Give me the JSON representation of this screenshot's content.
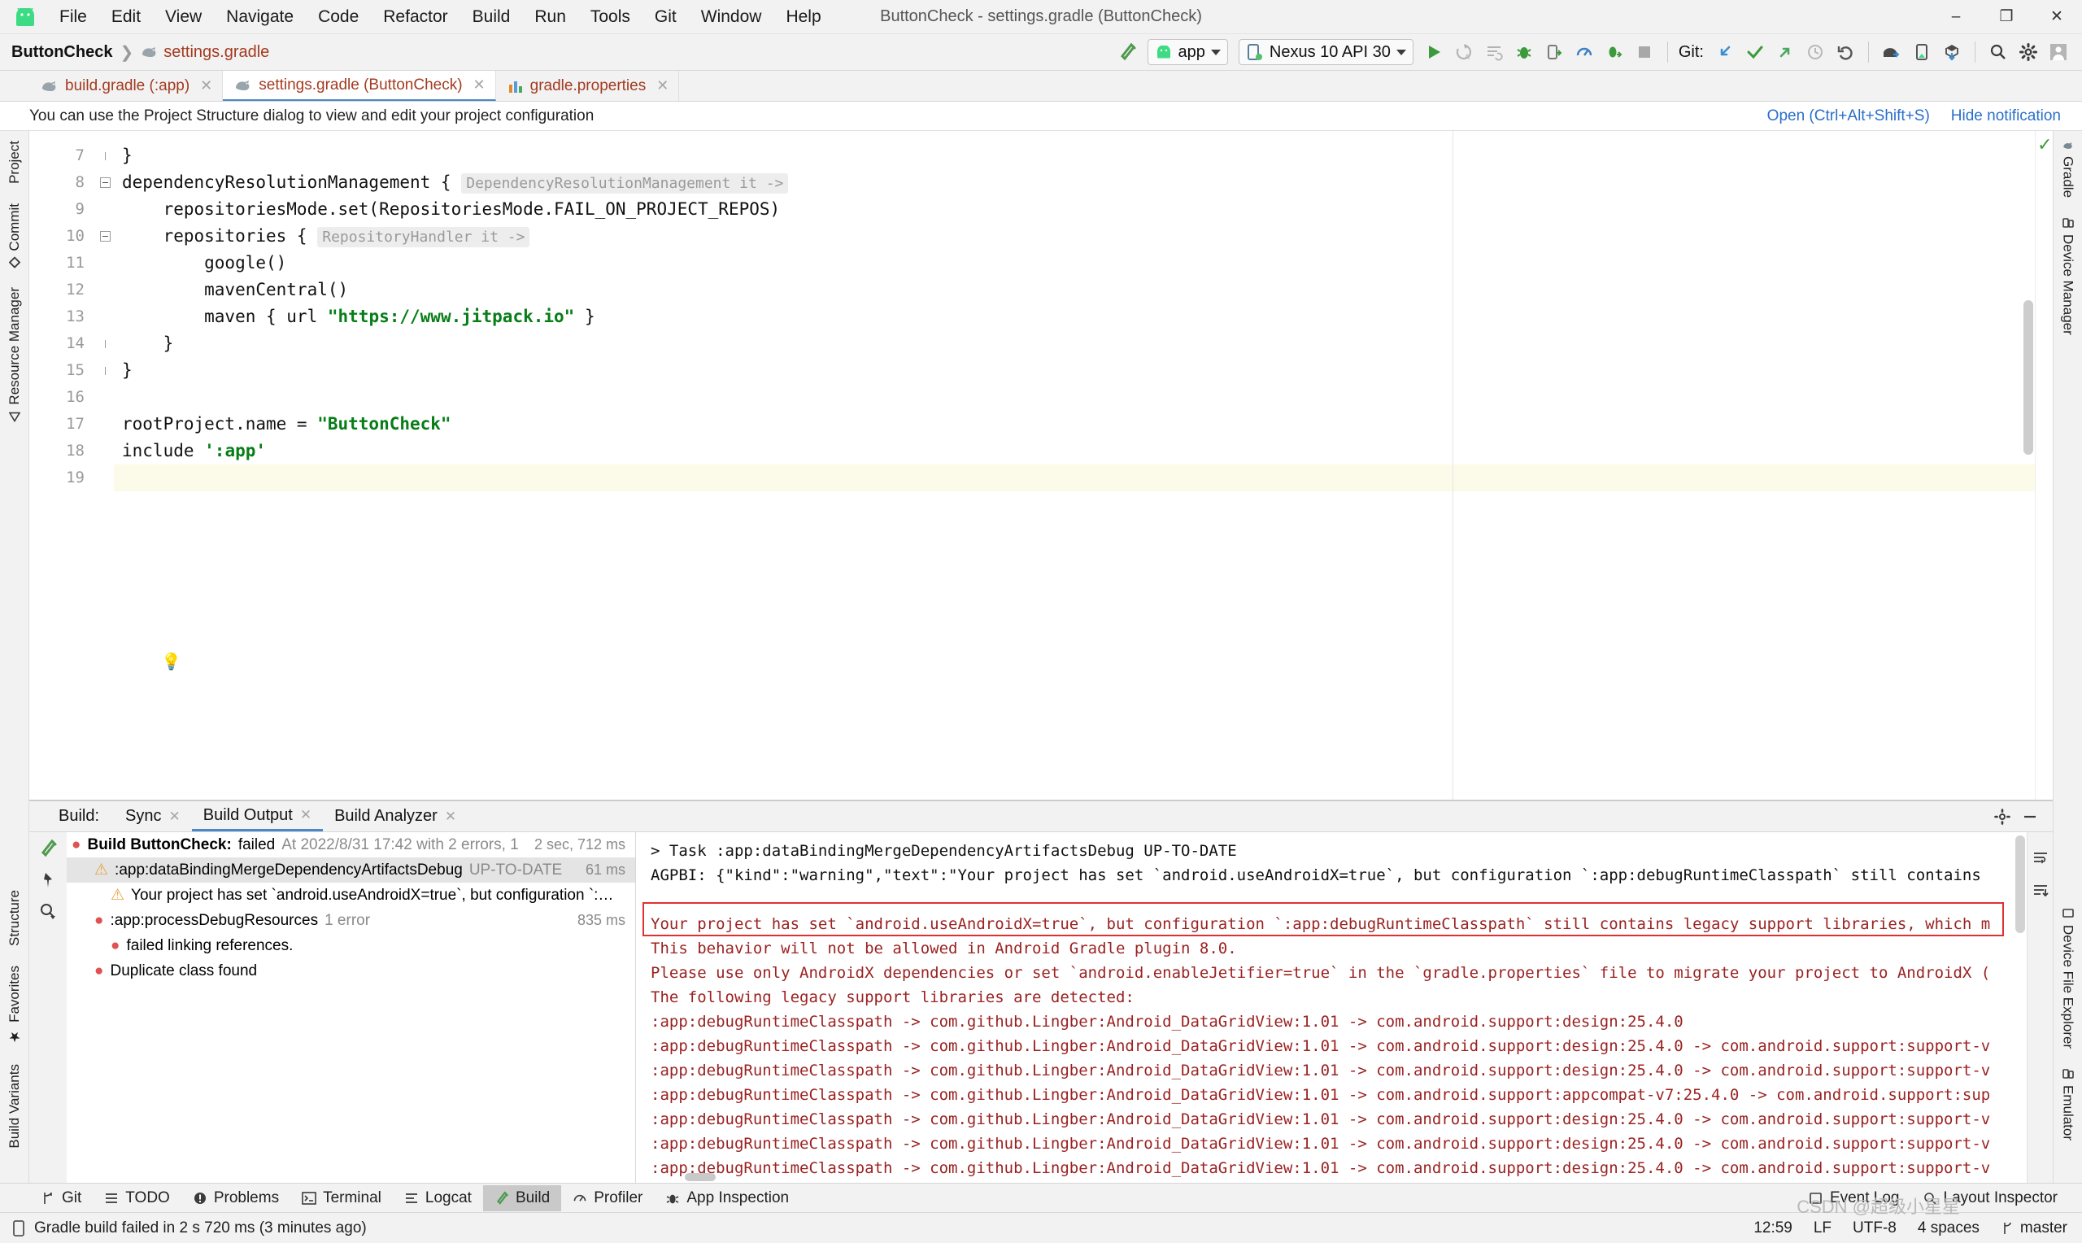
{
  "window": {
    "title": "ButtonCheck - settings.gradle (ButtonCheck)",
    "minimize": "–",
    "maximize": "❐",
    "close": "✕"
  },
  "menu": [
    {
      "label": "File"
    },
    {
      "label": "Edit"
    },
    {
      "label": "View"
    },
    {
      "label": "Navigate"
    },
    {
      "label": "Code"
    },
    {
      "label": "Refactor"
    },
    {
      "label": "Build"
    },
    {
      "label": "Run"
    },
    {
      "label": "Tools"
    },
    {
      "label": "Git"
    },
    {
      "label": "Window"
    },
    {
      "label": "Help"
    }
  ],
  "navbar": {
    "project": "ButtonCheck",
    "separator": "❯",
    "file": "settings.gradle",
    "run_config": "app",
    "device": "Nexus 10 API 30",
    "git_label": "Git:"
  },
  "editor_tabs": [
    {
      "label": "build.gradle (:app)",
      "icon": "gradle-icon",
      "active": false
    },
    {
      "label": "settings.gradle (ButtonCheck)",
      "icon": "gradle-icon",
      "active": true
    },
    {
      "label": "gradle.properties",
      "icon": "properties-icon",
      "active": false
    }
  ],
  "notification": {
    "text": "You can use the Project Structure dialog to view and edit your project configuration",
    "open_link": "Open (Ctrl+Alt+Shift+S)",
    "hide_link": "Hide notification"
  },
  "left_rail": [
    {
      "label": "Project"
    },
    {
      "label": "Commit"
    },
    {
      "label": "Resource Manager"
    }
  ],
  "right_rail": [
    {
      "label": "Gradle"
    },
    {
      "label": "Device Manager"
    },
    {
      "label": "Device File Explorer"
    },
    {
      "label": "Emulator"
    }
  ],
  "code": {
    "first_line": 7,
    "lines": [
      {
        "n": 7,
        "text": "}",
        "indent": 0
      },
      {
        "n": 8,
        "text": "dependencyResolutionManagement {",
        "hint": "DependencyResolutionManagement it ->"
      },
      {
        "n": 9,
        "text": "    repositoriesMode.set(RepositoriesMode.FAIL_ON_PROJECT_REPOS)"
      },
      {
        "n": 10,
        "text": "    repositories {",
        "hint": "RepositoryHandler it ->"
      },
      {
        "n": 11,
        "text": "        google()"
      },
      {
        "n": 12,
        "text": "        mavenCentral()"
      },
      {
        "n": 13,
        "text": "        maven { url \"https://www.jitpack.io\" }"
      },
      {
        "n": 14,
        "text": "    }"
      },
      {
        "n": 15,
        "text": "}"
      },
      {
        "n": 16,
        "text": ""
      },
      {
        "n": 17,
        "text": "rootProject.name = \"ButtonCheck\""
      },
      {
        "n": 18,
        "text": "include ':app'"
      },
      {
        "n": 19,
        "text": "",
        "current": true
      }
    ]
  },
  "build_panel": {
    "title": "Build:",
    "tabs": [
      {
        "label": "Sync",
        "active": false,
        "closable": true
      },
      {
        "label": "Build Output",
        "active": true,
        "closable": true
      },
      {
        "label": "Build Analyzer",
        "active": false,
        "closable": true
      }
    ],
    "tree": [
      {
        "level": 0,
        "icon": "error-icon",
        "bold": "Build ButtonCheck:",
        "text": " failed",
        "muted": " At 2022/8/31 17:42 with 2 errors, 1",
        "time": "2 sec, 712 ms",
        "selected": false
      },
      {
        "level": 1,
        "icon": "warning-icon",
        "text": ":app:dataBindingMergeDependencyArtifactsDebug",
        "muted": " UP-TO-DATE",
        "time": "61 ms",
        "selected": true
      },
      {
        "level": 2,
        "icon": "warning-icon",
        "text": "Your project has set `android.useAndroidX=true`, but configuration `:…",
        "time": "",
        "selected": false
      },
      {
        "level": 1,
        "icon": "error-icon",
        "text": ":app:processDebugResources",
        "muted": " 1 error",
        "time": "835 ms",
        "selected": false
      },
      {
        "level": 2,
        "icon": "error-icon",
        "text": "failed linking references.",
        "time": "",
        "selected": false
      },
      {
        "level": 1,
        "icon": "error-icon",
        "text": "Duplicate class found",
        "time": "",
        "selected": false
      }
    ],
    "log_lines": [
      {
        "text": "> Task :app:dataBindingMergeDependencyArtifactsDebug UP-TO-DATE",
        "red": false
      },
      {
        "text": "AGPBI: {\"kind\":\"warning\",\"text\":\"Your project has set `android.useAndroidX=true`, but configuration `:app:debugRuntimeClasspath` still contains",
        "red": false
      },
      {
        "text": "",
        "red": false
      },
      {
        "text": "Your project has set `android.useAndroidX=true`, but configuration `:app:debugRuntimeClasspath` still contains legacy support libraries, which m",
        "red": true,
        "highlighted": true
      },
      {
        "text": "This behavior will not be allowed in Android Gradle plugin 8.0.",
        "red": true
      },
      {
        "text": "Please use only AndroidX dependencies or set `android.enableJetifier=true` in the `gradle.properties` file to migrate your project to AndroidX (",
        "red": true
      },
      {
        "text": "The following legacy support libraries are detected:",
        "red": true
      },
      {
        "text": ":app:debugRuntimeClasspath -> com.github.Lingber:Android_DataGridView:1.01 -> com.android.support:design:25.4.0",
        "red": true
      },
      {
        "text": ":app:debugRuntimeClasspath -> com.github.Lingber:Android_DataGridView:1.01 -> com.android.support:design:25.4.0 -> com.android.support:support-v",
        "red": true
      },
      {
        "text": ":app:debugRuntimeClasspath -> com.github.Lingber:Android_DataGridView:1.01 -> com.android.support:design:25.4.0 -> com.android.support:support-v",
        "red": true
      },
      {
        "text": ":app:debugRuntimeClasspath -> com.github.Lingber:Android_DataGridView:1.01 -> com.android.support:appcompat-v7:25.4.0 -> com.android.support:sup",
        "red": true
      },
      {
        "text": ":app:debugRuntimeClasspath -> com.github.Lingber:Android_DataGridView:1.01 -> com.android.support:design:25.4.0 -> com.android.support:support-v",
        "red": true
      },
      {
        "text": ":app:debugRuntimeClasspath -> com.github.Lingber:Android_DataGridView:1.01 -> com.android.support:design:25.4.0 -> com.android.support:support-v",
        "red": true
      },
      {
        "text": ":app:debugRuntimeClasspath -> com.github.Lingber:Android_DataGridView:1.01 -> com.android.support:design:25.4.0 -> com.android.support:support-v",
        "red": true
      }
    ]
  },
  "tool_windows": [
    {
      "label": "Git",
      "icon": "git-icon",
      "active": false
    },
    {
      "label": "TODO",
      "icon": "todo-icon",
      "active": false
    },
    {
      "label": "Problems",
      "icon": "problems-icon",
      "active": false
    },
    {
      "label": "Terminal",
      "icon": "terminal-icon",
      "active": false
    },
    {
      "label": "Logcat",
      "icon": "logcat-icon",
      "active": false
    },
    {
      "label": "Build",
      "icon": "build-icon",
      "active": true
    },
    {
      "label": "Profiler",
      "icon": "profiler-icon",
      "active": false
    },
    {
      "label": "App Inspection",
      "icon": "app-inspection-icon",
      "active": false
    }
  ],
  "tool_windows_right": [
    {
      "label": "Event Log",
      "icon": "event-log-icon"
    },
    {
      "label": "Layout Inspector",
      "icon": "layout-inspector-icon"
    }
  ],
  "status_bar": {
    "message": "Gradle build failed in 2 s 720 ms (3 minutes ago)",
    "position": "12:59",
    "line_sep": "LF",
    "encoding": "UTF-8",
    "indent": "4 spaces",
    "branch": "master"
  },
  "watermark": "CSDN @超级小星星",
  "colors": {
    "accent_blue": "#4a88c7",
    "error_red": "#9b2222",
    "highlight_red": "#e03030",
    "warning_orange": "#e8a33d",
    "link_blue": "#2a6fc9",
    "string_green": "#067d17",
    "keyword_blue": "#0033b3",
    "gradle_brown": "#a33b20",
    "android_green": "#3ddc84"
  }
}
